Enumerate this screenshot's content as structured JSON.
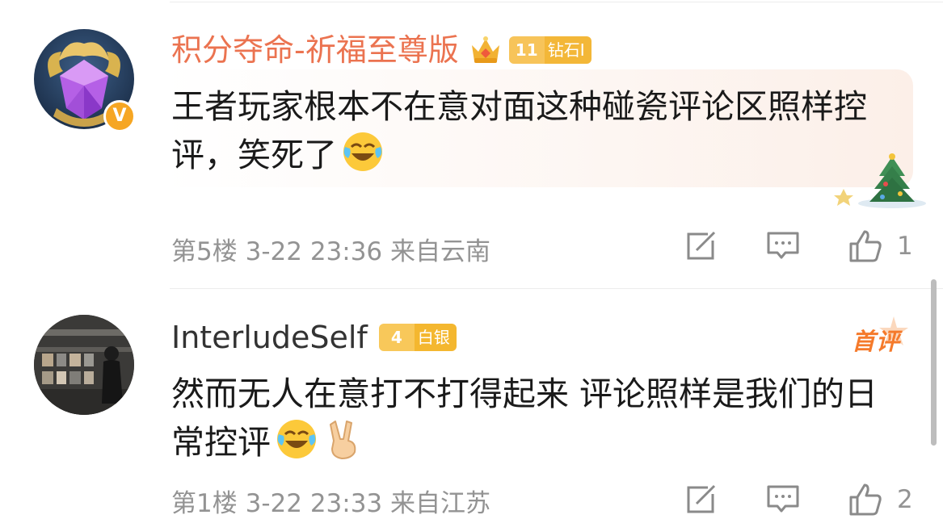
{
  "comments": [
    {
      "username": "积分夺命-祈福至尊版",
      "level_number": "11",
      "level_name": "钻石I",
      "text_before_emoji": "王者玩家根本不在意对面这种碰瓷评论区照样控评，笑死了",
      "floor": "第5楼",
      "date": "3-22",
      "time": "23:36",
      "location": "来自云南",
      "like_count": "1",
      "emojis": [
        "laugh-cry-emoji"
      ]
    },
    {
      "username": "InterludeSelf",
      "level_number": "4",
      "level_name": "白银",
      "first_label": "首评",
      "text_before_emoji": "然而无人在意打不打得起来 评论照样是我们的日常控评",
      "floor": "第1楼",
      "date": "3-22",
      "time": "23:33",
      "location": "来自江苏",
      "like_count": "2",
      "emojis": [
        "laugh-cry-emoji",
        "victory-hand-emoji"
      ]
    }
  ],
  "colors": {
    "vip_name": "#eb7350",
    "normal_name": "#333333",
    "meta_gray": "#939393",
    "badge_gold": "#f4b72f",
    "first_orange": "#f57a2b"
  }
}
